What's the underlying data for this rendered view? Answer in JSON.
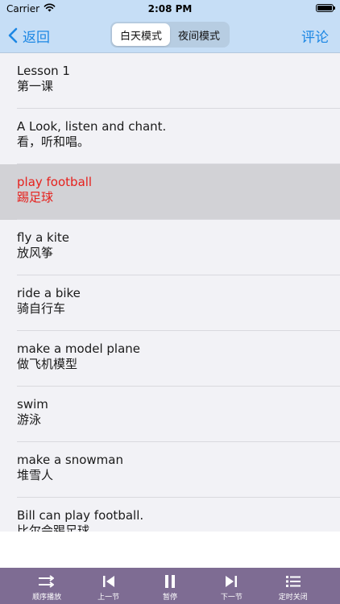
{
  "status_bar": {
    "carrier": "Carrier",
    "time": "2:08 PM",
    "battery_level": 1.0
  },
  "nav": {
    "back_label": "返回",
    "segments": [
      "白天模式",
      "夜间模式"
    ],
    "selected_segment": "白天模式",
    "comment_label": "评论"
  },
  "lesson_rows": [
    {
      "en": "Lesson 1",
      "zh": "第一课"
    },
    {
      "en": "A Look, listen and chant.",
      "zh": "看，听和唱。"
    },
    {
      "en": "play football",
      "zh": "踢足球",
      "selected": true
    },
    {
      "en": "fly a kite",
      "zh": "放风筝"
    },
    {
      "en": "ride a bike",
      "zh": "骑自行车"
    },
    {
      "en": "make a model plane",
      "zh": "做飞机模型"
    },
    {
      "en": "swim",
      "zh": "游泳"
    },
    {
      "en": "make a snowman",
      "zh": "堆雪人"
    },
    {
      "en": "Bill can play football.",
      "zh": "比尔会踢足球"
    }
  ],
  "toolbar": {
    "order_play_label": "顺序播放",
    "prev_label": "上一节",
    "pause_label": "暂停",
    "next_label": "下一节",
    "timer_off_label": "定时关闭"
  },
  "colors": {
    "nav_background": "#c6def6",
    "accent_blue": "#1c87e4",
    "selected_text": "#e6201c",
    "selected_row": "#d2d2d6",
    "toolbar_background": "#7e6c93"
  },
  "icons": {
    "wifi": "wifi-icon",
    "battery": "battery-icon",
    "back": "chevron-left-icon",
    "order_play": "shuffle-arrows-icon",
    "prev": "skip-back-icon",
    "pause": "pause-icon",
    "next": "skip-forward-icon",
    "timer": "list-icon"
  }
}
